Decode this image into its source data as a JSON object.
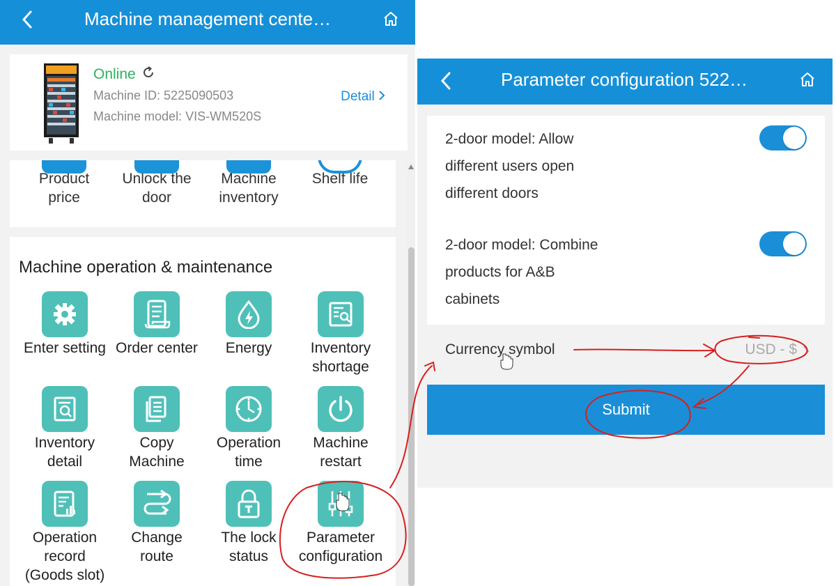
{
  "left": {
    "header": {
      "title": "Machine management cente…"
    },
    "machine": {
      "status": "Online",
      "id_line": "Machine ID: 5225090503",
      "model_line": "Machine model: VIS-WM520S",
      "detail": "Detail"
    },
    "features": [
      {
        "label": "Product\nprice"
      },
      {
        "label": "Unlock the\ndoor"
      },
      {
        "label": "Machine\ninventory"
      },
      {
        "label": "Shelf life"
      }
    ],
    "ops": {
      "title": "Machine operation & maintenance",
      "items": [
        {
          "label": "Enter setting",
          "icon": "gear-icon"
        },
        {
          "label": "Order center",
          "icon": "scroll-icon"
        },
        {
          "label": "Energy",
          "icon": "energy-drop-icon"
        },
        {
          "label": "Inventory\nshortage",
          "icon": "report-search-icon"
        },
        {
          "label": "Inventory\ndetail",
          "icon": "document-search-icon"
        },
        {
          "label": "Copy\nMachine",
          "icon": "copy-icon"
        },
        {
          "label": "Operation\ntime",
          "icon": "clock-icon"
        },
        {
          "label": "Machine\nrestart",
          "icon": "power-icon"
        },
        {
          "label": "Operation\nrecord\n(Goods slot)",
          "icon": "record-icon"
        },
        {
          "label": "Change\nroute",
          "icon": "route-icon"
        },
        {
          "label": "The lock\nstatus",
          "icon": "lock-icon"
        },
        {
          "label": "Parameter\nconfiguration",
          "icon": "sliders-icon"
        }
      ]
    }
  },
  "right": {
    "header": {
      "title": "Parameter configuration 522…"
    },
    "settings": [
      {
        "label": "2-door model: Allow\ndifferent users open\ndifferent doors",
        "enabled": true
      },
      {
        "label": "2-door model: Combine\nproducts for A&B\ncabinets",
        "enabled": true
      }
    ],
    "currency": {
      "label": "Currency symbol",
      "value": "USD - $"
    },
    "submit": "Submit"
  },
  "colors": {
    "header_blue": "#1590d8",
    "icon_teal": "#4fc0b8",
    "online_green": "#2bb35a",
    "annotation_red": "#d81e1e"
  }
}
